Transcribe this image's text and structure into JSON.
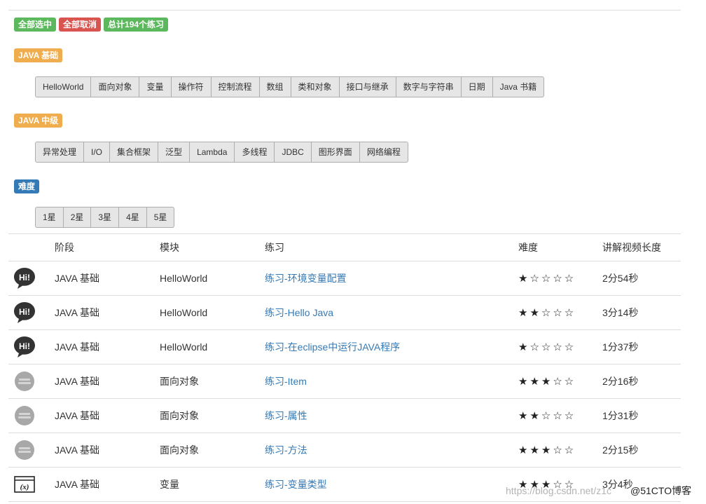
{
  "actions": {
    "select_all": "全部选中",
    "deselect_all": "全部取消",
    "total": "总计194个练习"
  },
  "sections": {
    "basic": {
      "label": "JAVA 基础",
      "buttons": [
        "HelloWorld",
        "面向对象",
        "变量",
        "操作符",
        "控制流程",
        "数组",
        "类和对象",
        "接口与继承",
        "数字与字符串",
        "日期",
        "Java 书籍"
      ]
    },
    "intermediate": {
      "label": "JAVA 中级",
      "buttons": [
        "异常处理",
        "I/O",
        "集合框架",
        "泛型",
        "Lambda",
        "多线程",
        "JDBC",
        "图形界面",
        "网络编程"
      ]
    },
    "difficulty": {
      "label": "难度",
      "buttons": [
        "1星",
        "2星",
        "3星",
        "4星",
        "5星"
      ]
    }
  },
  "table": {
    "headers": [
      "阶段",
      "模块",
      "练习",
      "难度",
      "讲解视频长度"
    ],
    "rows": [
      {
        "icon": "hi-bubble-icon",
        "stage": "JAVA 基础",
        "module": "HelloWorld",
        "exercise": "练习-环境变量配置",
        "stars": "★☆☆☆☆",
        "duration": "2分54秒"
      },
      {
        "icon": "hi-bubble-icon",
        "stage": "JAVA 基础",
        "module": "HelloWorld",
        "exercise": "练习-Hello Java",
        "stars": "★★☆☆☆",
        "duration": "3分14秒"
      },
      {
        "icon": "hi-bubble-icon",
        "stage": "JAVA 基础",
        "module": "HelloWorld",
        "exercise": "练习-在eclipse中运行JAVA程序",
        "stars": "★☆☆☆☆",
        "duration": "1分37秒"
      },
      {
        "icon": "object-badge-icon",
        "stage": "JAVA 基础",
        "module": "面向对象",
        "exercise": "练习-Item",
        "stars": "★★★☆☆",
        "duration": "2分16秒"
      },
      {
        "icon": "object-badge-icon",
        "stage": "JAVA 基础",
        "module": "面向对象",
        "exercise": "练习-属性",
        "stars": "★★☆☆☆",
        "duration": "1分31秒"
      },
      {
        "icon": "object-badge-icon",
        "stage": "JAVA 基础",
        "module": "面向对象",
        "exercise": "练习-方法",
        "stars": "★★★☆☆",
        "duration": "2分15秒"
      },
      {
        "icon": "variable-x-icon",
        "stage": "JAVA 基础",
        "module": "变量",
        "exercise": "练习-变量类型",
        "stars": "★★★☆☆",
        "duration": "3分4秒"
      }
    ]
  },
  "watermark": "https://blog.csdn.net/z1c",
  "brand": "@51CTO博客"
}
